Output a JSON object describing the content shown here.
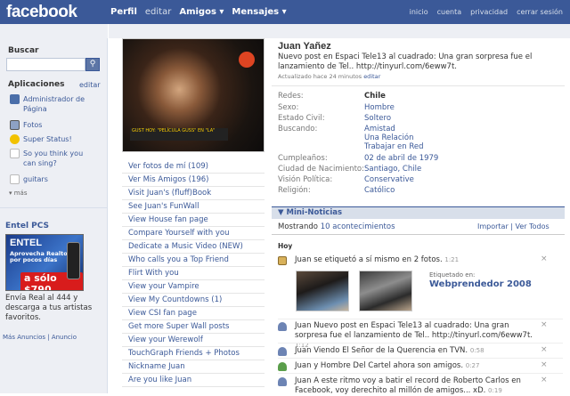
{
  "header": {
    "logo": "facebook",
    "nav": [
      {
        "label": "Perfil",
        "bold": true
      },
      {
        "label": "editar",
        "bold": false
      },
      {
        "label": "Amigos ▾",
        "bold": true
      },
      {
        "label": "Mensajes ▾",
        "bold": true
      }
    ],
    "right_links": [
      "inicio",
      "cuenta",
      "privacidad",
      "cerrar sesión"
    ]
  },
  "sidebar": {
    "search_label": "Buscar",
    "search_placeholder": "",
    "search_button_icon": "magnifier-icon",
    "apps_label": "Aplicaciones",
    "apps_edit": "editar",
    "apps": [
      {
        "label": "Administrador de Página",
        "icon": "admin-page-icon",
        "color": "#4a6ea9"
      },
      {
        "label": "Fotos",
        "icon": "photos-icon",
        "color": "#8da1c4"
      },
      {
        "label": "Super Status!",
        "icon": "smiley-icon",
        "color": "#f2c200"
      },
      {
        "label": "So you think you can sing?",
        "icon": "generic-app-icon",
        "color": "#ffffff"
      },
      {
        "label": "guitars",
        "icon": "generic-app-icon",
        "color": "#ffffff"
      }
    ],
    "more_label": "▾ más",
    "ad": {
      "title": "Entel PCS",
      "image_brand": "ENTEL",
      "image_text": "Aprovecha Realtones por pocos días",
      "image_price": "a sólo $790",
      "body": "Envía Real al 444 y descarga a tus artistas favoritos."
    },
    "bottom_links": "Más Anuncios | Anuncio"
  },
  "profile": {
    "name": "Juan Yañez",
    "status": "Nuevo post en Espaci Tele13 al cuadrado: Una gran sorpresa fue el lanzamiento de Tel.. http://tinyurl.com/6eww7t.",
    "updated": "Actualizado hace 24 minutos",
    "updated_edit": "editar",
    "info": [
      {
        "key": "Redes:",
        "value": "Chile",
        "bold": true
      },
      {
        "key": "Sexo:",
        "value": "Hombre"
      },
      {
        "key": "Estado Civil:",
        "value": "Soltero"
      },
      {
        "key": "Buscando:",
        "value": "Amistad\nUna Relación\nTrabajar en Red"
      },
      {
        "key": "Cumpleaños:",
        "value": "02 de abril de 1979"
      },
      {
        "key": "Ciudad de Nacimiento:",
        "value": "Santiago, Chile"
      },
      {
        "key": "Visión Política:",
        "value": "Conservative"
      },
      {
        "key": "Religión:",
        "value": "Católico"
      }
    ],
    "photo_caption": "GUST HOY: \"PELÍCULA GUSS\" EN \"LA\""
  },
  "profile_links": [
    "Ver fotos de mí (109)",
    "Ver Mis Amigos (196)",
    "Visit Juan's (fluff)Book",
    "See Juan's FunWall",
    "View House fan page",
    "Compare Yourself with you",
    "Dedicate a Music Video (NEW)",
    "Who calls you a Top Friend",
    "Flirt With you",
    "View your Vampire",
    "View My Countdowns (1)",
    "View CSI fan page",
    "Get more Super Wall posts",
    "View your Werewolf",
    "TouchGraph Friends + Photos",
    "Nickname Juan",
    "Are you like Juan"
  ],
  "mini_feed": {
    "title": "▼ Mini-Noticias",
    "count_prefix": "Mostrando ",
    "count": "10 acontecimientos",
    "actions": "Importar | Ver Todos",
    "today": "Hoy",
    "stories": [
      {
        "text": "Juan se etiquetó a sí mismo en 2 fotos.",
        "time": "1:21",
        "icon": "photo-tag-icon"
      },
      {
        "text": "Juan Nuevo post en Espaci Tele13 al cuadrado: Una gran sorpresa fue el lanzamiento de Tel.. http://tinyurl.com/6eww7t.",
        "time": "1:12",
        "icon": "status-person-icon"
      },
      {
        "text": "Juan Viendo El Señor de la Querencia en TVN.",
        "time": "0:58",
        "icon": "status-person-icon"
      },
      {
        "text": "Juan y Hombre Del Cartel ahora son amigos.",
        "time": "0:27",
        "icon": "friends-icon"
      },
      {
        "text": "Juan A este ritmo voy a batir el record de Roberto Carlos en Facebook, voy derechito al millón de amigos... xD.",
        "time": "0:19",
        "icon": "status-person-icon"
      }
    ],
    "tag": {
      "label": "Etiquetado en:",
      "name": "Webprendedor 2008"
    }
  }
}
